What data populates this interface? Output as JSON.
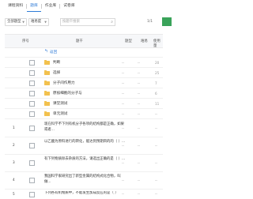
{
  "tabs": [
    {
      "label": "课程资料"
    },
    {
      "label": "题库"
    },
    {
      "label": "作业库"
    },
    {
      "label": "试卷库"
    }
  ],
  "active_tab": 1,
  "toolbar": {
    "filter_type": "全部题型",
    "filter_difficulty": "难易度",
    "search_placeholder": "按题干搜索",
    "page_indicator": "1/1",
    "action_color": "#3aa35a"
  },
  "table": {
    "headers": {
      "index": "序号",
      "stem": "题干",
      "type": "题型",
      "difficulty": "难易",
      "usage": "使用量"
    },
    "back_label": "返回",
    "folders": [
      {
        "name": "判断",
        "type": "--",
        "difficulty": "--",
        "usage": "20"
      },
      {
        "name": "选择",
        "type": "--",
        "difficulty": "--",
        "usage": "25"
      },
      {
        "name": "分子间作用力",
        "type": "--",
        "difficulty": "--",
        "usage": "7"
      },
      {
        "name": "原核细胞的分子与",
        "type": "--",
        "difficulty": "--",
        "usage": "6"
      },
      {
        "name": "课堂测试",
        "type": "--",
        "difficulty": "--",
        "usage": "11"
      },
      {
        "name": "单元测试",
        "type": "--",
        "difficulty": "--",
        "usage": "--"
      }
    ],
    "questions": [
      {
        "no": "1",
        "stem": "现在科学不下列有机分子各项的结构都是正确，如果或者...",
        "type": "--",
        "difficulty": "--",
        "usage": "--"
      },
      {
        "no": "2",
        "stem": "以乙酸为原料进行的转化，能达到预期目的的（ ）...",
        "type": "--",
        "difficulty": "--",
        "usage": "--"
      },
      {
        "no": "3",
        "stem": "有下列物质除去杂质的方法，请选出正确的是（ ）...",
        "type": "--",
        "difficulty": "--",
        "usage": "--"
      },
      {
        "no": "4",
        "stem": "我国科学家研究出了新型金属的结构式化合物，叫做...",
        "type": "--",
        "difficulty": "--",
        "usage": "--"
      },
      {
        "no": "5",
        "stem": "下列各有机物质中，不能发生加成反应的是（ ）",
        "type": "--",
        "difficulty": "--",
        "usage": "--"
      }
    ]
  }
}
